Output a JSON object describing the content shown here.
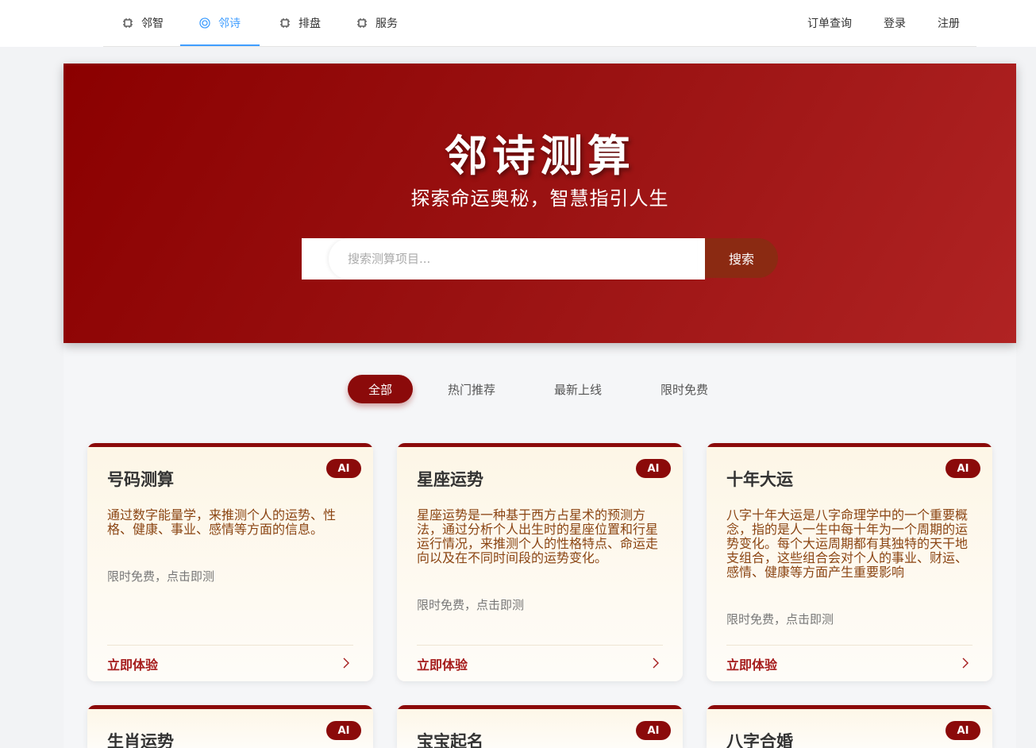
{
  "nav": {
    "items": [
      {
        "label": "邻智",
        "icon": "chip-icon"
      },
      {
        "label": "邻诗",
        "icon": "ring-icon",
        "active": true
      },
      {
        "label": "排盘",
        "icon": "chip-icon"
      },
      {
        "label": "服务",
        "icon": "chip-icon"
      }
    ],
    "right": [
      "订单查询",
      "登录",
      "注册"
    ]
  },
  "hero": {
    "title": "邻诗测算",
    "subtitle": "探索命运奥秘，智慧指引人生",
    "search_placeholder": "搜索测算项目...",
    "search_button": "搜索"
  },
  "tabs": [
    "全部",
    "热门推荐",
    "最新上线",
    "限时免费"
  ],
  "active_tab": "全部",
  "cards": [
    {
      "title": "号码测算",
      "badge": "AI",
      "desc": "通过数字能量学，来推测个人的运势、性格、健康、事业、感情等方面的信息。",
      "note": "限时免费，点击即测",
      "cta": "立即体验"
    },
    {
      "title": "星座运势",
      "badge": "AI",
      "desc": "星座运势是一种基于西方占星术的预测方法，通过分析个人出生时的星座位置和行星运行情况，来推测个人的性格特点、命运走向以及在不同时间段的运势变化。",
      "note": "限时免费，点击即测",
      "cta": "立即体验"
    },
    {
      "title": "十年大运",
      "badge": "AI",
      "desc": "八字十年大运是八字命理学中的一个重要概念，指的是人一生中每十年为一个周期的运势变化。每个大运周期都有其独特的天干地支组合，这些组合会对个人的事业、财运、感情、健康等方面产生重要影响",
      "note": "限时免费，点击即测",
      "cta": "立即体验"
    },
    {
      "title": "生肖运势",
      "badge": "AI"
    },
    {
      "title": "宝宝起名",
      "badge": "AI"
    },
    {
      "title": "八字合婚",
      "badge": "AI"
    }
  ],
  "colors": {
    "brand": "#8b0a0a",
    "nav_active": "#409eff",
    "desc_text": "#8b4513"
  }
}
